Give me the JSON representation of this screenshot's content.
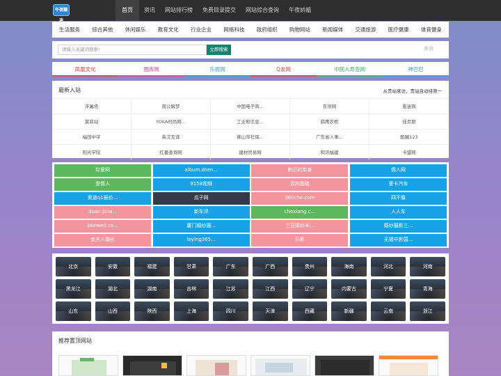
{
  "logo": {
    "text": "午夜蹦迪"
  },
  "topnav": [
    "首页",
    "资讯",
    "网站排行榜",
    "免费目录提交",
    "网站综合查询",
    "午夜娇媚"
  ],
  "categories": [
    "生活服务",
    "综合其他",
    "休闲娱乐",
    "教育文化",
    "行业企业",
    "网络科技",
    "政府组织",
    "购物网站",
    "新闻媒体",
    "交通旅游",
    "医疗健康",
    "体育健身"
  ],
  "search": {
    "placeholder": "请输入关键词搜索!",
    "button": "立即搜索",
    "right_text": "美食"
  },
  "featured": [
    {
      "label": "凤凰文化",
      "color": "#e03a3a"
    },
    {
      "label": "图库网",
      "color": "#e0408f"
    },
    {
      "label": "乐视网",
      "color": "#3a98d8"
    },
    {
      "label": "Q友网",
      "color": "#e03a3a"
    },
    {
      "label": "中国人寿查网",
      "color": "#3fae6e"
    },
    {
      "label": "神巴巴",
      "color": "#3a98d8"
    }
  ],
  "newest": {
    "title": "最新入站",
    "subtitle": "从贵站来访，贵站自动排第一",
    "items": [
      "浮屠塔",
      "周公解梦",
      "中国电子商...",
      "东坝网",
      "看迷网",
      "莫菲站",
      "YOKA时尚网...",
      "工业和信息...",
      "鹞鹰农柜",
      "佳尼斯",
      "福田中学",
      "英汉互译",
      "佛山市社保...",
      "广东省人事...",
      "酷圈123",
      "阳光学院",
      "红番查询网",
      "建材贸易网",
      "和讯福建",
      "卡盟网"
    ]
  },
  "colored": [
    {
      "label": "珍爱网",
      "c": "g"
    },
    {
      "label": "album.zhen...",
      "c": "b"
    },
    {
      "label": "附近的单身",
      "c": "p"
    },
    {
      "label": "情人网",
      "c": "b"
    },
    {
      "label": "爱情人",
      "c": "g"
    },
    {
      "label": "9158视频",
      "c": "b"
    },
    {
      "label": "百利基础",
      "c": "p"
    },
    {
      "label": "爱卡汽车",
      "c": "b"
    },
    {
      "label": "奥迪q1报价...",
      "c": "b"
    },
    {
      "label": "瓜子网",
      "c": "d"
    },
    {
      "label": "360che.com",
      "c": "p"
    },
    {
      "label": "四不像",
      "c": "b"
    },
    {
      "label": "duan.jiina...",
      "c": "p"
    },
    {
      "label": "新车评",
      "c": "b"
    },
    {
      "label": "chexiang.c...",
      "c": "g"
    },
    {
      "label": "人人车",
      "c": "b"
    },
    {
      "label": "bkewed.co...",
      "c": "p"
    },
    {
      "label": "厦门婚纱摄...",
      "c": "b"
    },
    {
      "label": "三亚婚纱米...",
      "c": "p"
    },
    {
      "label": "婚纱摄影三...",
      "c": "b"
    },
    {
      "label": "金夫人婚纱",
      "c": "p"
    },
    {
      "label": "leying365...",
      "c": "b"
    },
    {
      "label": "乐影",
      "c": "p"
    },
    {
      "label": "无锡中影国...",
      "c": "b"
    }
  ],
  "provinces": [
    "北京",
    "安徽",
    "福建",
    "甘肃",
    "广东",
    "广西",
    "贵州",
    "海南",
    "河北",
    "河南",
    "黑龙江",
    "湖北",
    "湖南",
    "吉林",
    "江苏",
    "江西",
    "辽宁",
    "内蒙古",
    "宁夏",
    "青海",
    "山东",
    "山西",
    "陕西",
    "上海",
    "四川",
    "天津",
    "西藏",
    "新疆",
    "云南",
    "浙江"
  ],
  "recommend": {
    "title": "推荐置顶网站"
  },
  "colors": {
    "topbar": "#2e2e2e",
    "search_button": "#12836d",
    "green": "#5cb85c",
    "blue": "#17a2e8",
    "pink": "#f4949c",
    "dark": "#343a48"
  }
}
